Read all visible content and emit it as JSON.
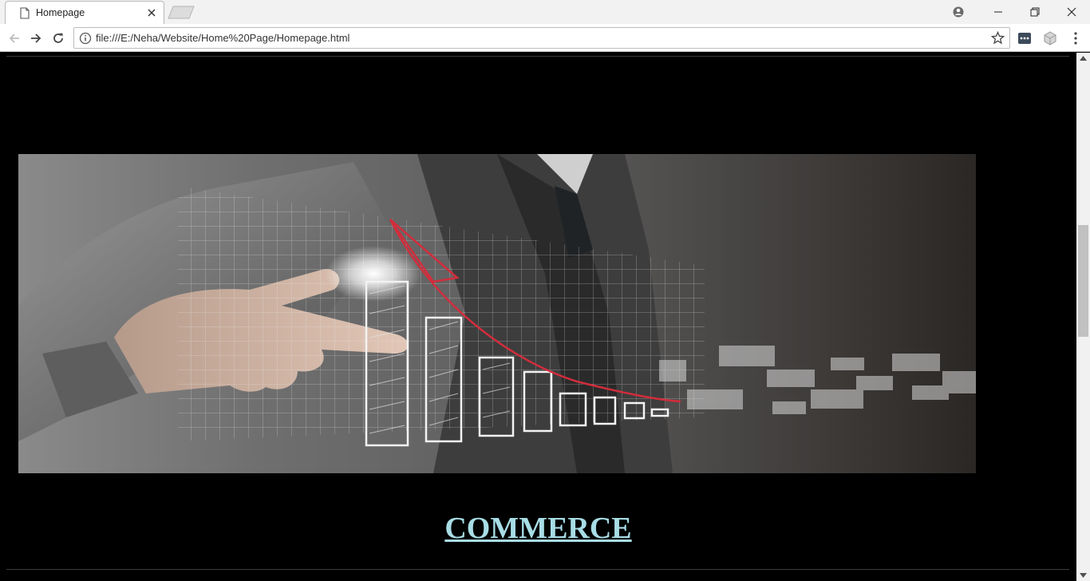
{
  "browser": {
    "tab_title": "Homepage",
    "url": "file:///E:/Neha/Website/Home%20Page/Homepage.html"
  },
  "page": {
    "hero_image_alt": "",
    "section_heading": "COMMERCE"
  },
  "colors": {
    "page_background": "#000000",
    "heading_link": "#a8dde6",
    "divider": "#3a3a3a"
  },
  "icons": [
    "page-icon",
    "close-icon",
    "new-tab-icon",
    "profile-icon",
    "minimize-icon",
    "restore-icon",
    "window-close-icon",
    "back-arrow-icon",
    "forward-arrow-icon",
    "reload-icon",
    "info-icon",
    "star-icon",
    "extension-icon",
    "extension-cube-icon",
    "kebab-menu-icon"
  ]
}
